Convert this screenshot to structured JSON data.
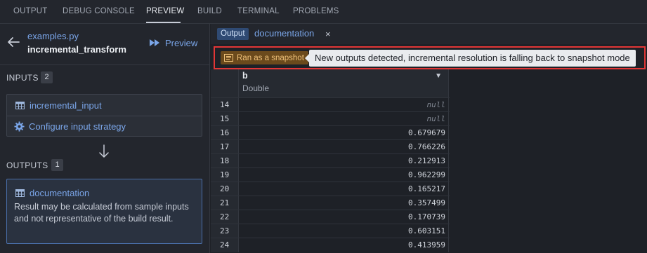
{
  "top_tabs": [
    "OUTPUT",
    "DEBUG CONSOLE",
    "PREVIEW",
    "BUILD",
    "TERMINAL",
    "PROBLEMS"
  ],
  "active_tab": "PREVIEW",
  "sidebar": {
    "file_name": "examples.py",
    "transform_name": "incremental_transform",
    "preview_label": "Preview",
    "inputs_label": "INPUTS",
    "inputs_count": "2",
    "input_name": "incremental_input",
    "configure_label": "Configure input strategy",
    "outputs_label": "OUTPUTS",
    "outputs_count": "1",
    "output_name": "documentation",
    "output_description": "Result may be calculated from sample inputs and not representative of the build result."
  },
  "doc_tab": {
    "chip": "Output",
    "title": "documentation",
    "close": "×"
  },
  "banner": {
    "badge": "Ran as a snapshot",
    "tooltip": "New outputs detected, incremental resolution is falling back to snapshot mode"
  },
  "table": {
    "column_name": "b",
    "column_type": "Double",
    "rows": [
      {
        "idx": "14",
        "value": "null",
        "is_null": true
      },
      {
        "idx": "15",
        "value": "null",
        "is_null": true
      },
      {
        "idx": "16",
        "value": "0.679679",
        "is_null": false
      },
      {
        "idx": "17",
        "value": "0.766226",
        "is_null": false
      },
      {
        "idx": "18",
        "value": "0.212913",
        "is_null": false
      },
      {
        "idx": "19",
        "value": "0.962299",
        "is_null": false
      },
      {
        "idx": "20",
        "value": "0.165217",
        "is_null": false
      },
      {
        "idx": "21",
        "value": "0.357499",
        "is_null": false
      },
      {
        "idx": "22",
        "value": "0.170739",
        "is_null": false
      },
      {
        "idx": "23",
        "value": "0.603151",
        "is_null": false
      },
      {
        "idx": "24",
        "value": "0.413959",
        "is_null": false
      }
    ]
  },
  "colors": {
    "accent": "#7aa5e8",
    "highlight_border": "#e23636",
    "snapshot_badge_bg": "#6b4a1c",
    "snapshot_badge_text": "#f0c27a"
  }
}
